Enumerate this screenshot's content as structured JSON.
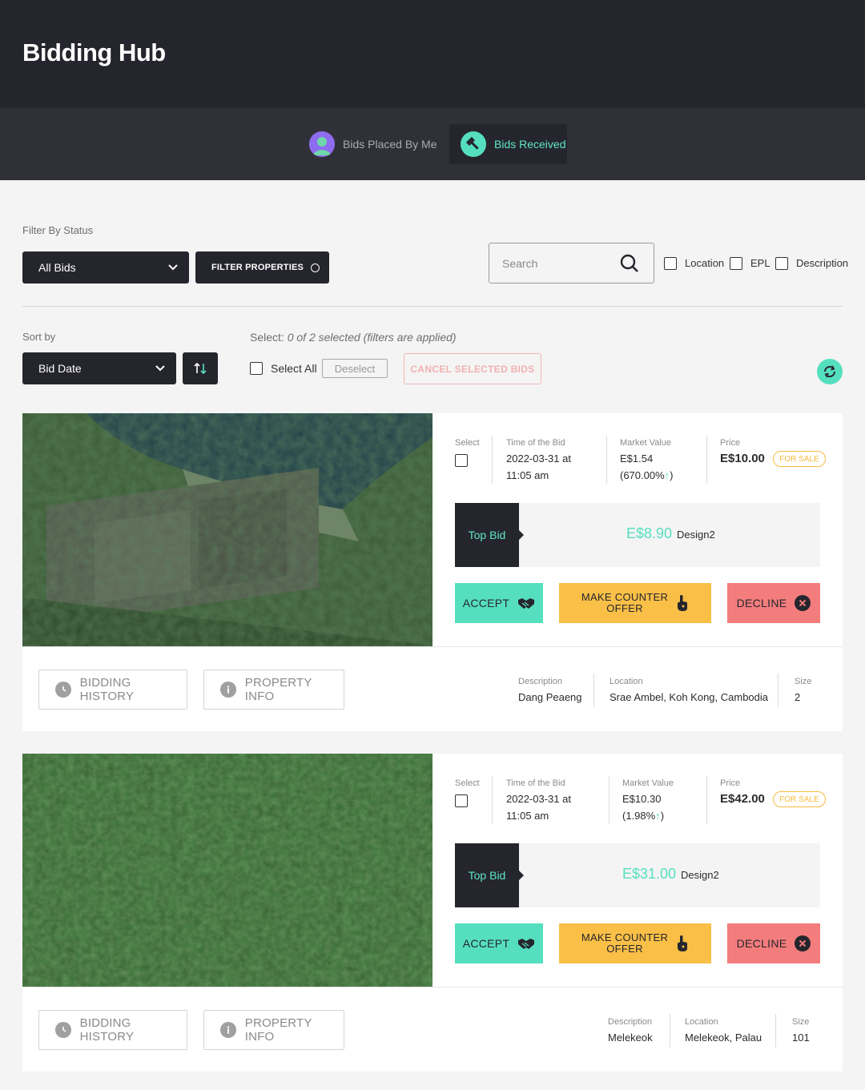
{
  "app": {
    "title": "Bidding Hub"
  },
  "tabs": [
    {
      "label": "Bids Placed By Me",
      "icon": "user-avatar-icon",
      "active": false
    },
    {
      "label": "Bids Received",
      "icon": "gavel-icon",
      "active": true
    }
  ],
  "filters": {
    "status_label": "Filter By Status",
    "status_value": "All Bids",
    "filter_button": "FILTER PROPERTIES",
    "search_placeholder": "Search",
    "search_fields": [
      "Location",
      "EPL",
      "Description"
    ]
  },
  "sort": {
    "label": "Sort by",
    "value": "Bid Date"
  },
  "selection": {
    "prefix": "Select:",
    "status": "0 of 2 selected (filters are applied)",
    "select_all": "Select All",
    "deselect": "Deselect",
    "cancel_selected": "CANCEL SELECTED BIDS"
  },
  "labels": {
    "select": "Select",
    "time": "Time of the Bid",
    "market": "Market Value",
    "price": "Price",
    "for_sale": "FOR SALE",
    "top_bid": "Top Bid",
    "accept": "ACCEPT",
    "counter_line1": "MAKE COUNTER",
    "counter_line2": "OFFER",
    "decline": "DECLINE",
    "history": "BIDDING HISTORY",
    "info": "PROPERTY INFO",
    "description": "Description",
    "location": "Location",
    "size": "Size"
  },
  "bids": [
    {
      "time_line1": "2022-03-31 at",
      "time_line2": "11:05 am",
      "market_value": "E$1.54",
      "market_change": "(670.00%",
      "market_change_end": ")",
      "price": "E$10.00",
      "top_bid_amount": "E$8.90",
      "top_bidder": "Design2",
      "description": "Dang Peaeng",
      "location": "Srae Ambel, Koh Kong, Cambodia",
      "size": "2"
    },
    {
      "time_line1": "2022-03-31 at",
      "time_line2": "11:05 am",
      "market_value": "E$10.30",
      "market_change": "(1.98%",
      "market_change_end": ")",
      "price": "E$42.00",
      "top_bid_amount": "E$31.00",
      "top_bidder": "Design2",
      "description": "Melekeok",
      "location": "Melekeok, Palau",
      "size": "101"
    }
  ],
  "colors": {
    "dark": "#25262d",
    "accent": "#55dfbf",
    "counter": "#f9bf47",
    "decline": "#f37c7c",
    "for_sale": "#f7bb41"
  }
}
